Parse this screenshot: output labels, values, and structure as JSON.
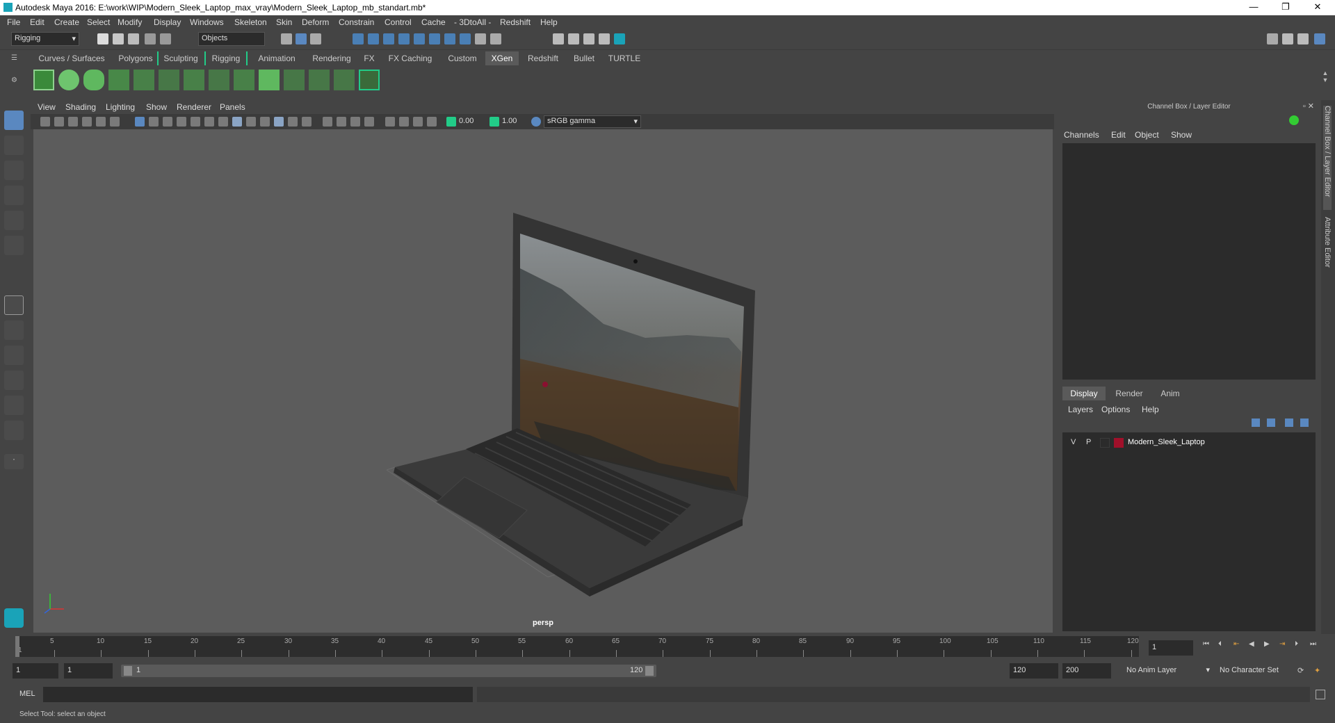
{
  "window": {
    "title": "Autodesk Maya 2016: E:\\work\\WIP\\Modern_Sleek_Laptop_max_vray\\Modern_Sleek_Laptop_mb_standart.mb*",
    "minimize": "—",
    "maximize": "❐",
    "close": "✕"
  },
  "menu": [
    "File",
    "Edit",
    "Create",
    "Select",
    "Modify",
    "Display",
    "Windows",
    "Skeleton",
    "Skin",
    "Deform",
    "Constrain",
    "Control",
    "Cache",
    "- 3DtoAll -",
    "Redshift",
    "Help"
  ],
  "toolbar": {
    "mode": "Rigging",
    "objects_field": "Objects"
  },
  "shelf_tabs": [
    "Curves / Surfaces",
    "Polygons",
    "Sculpting",
    "Rigging",
    "Animation",
    "Rendering",
    "FX",
    "FX Caching",
    "Custom",
    "XGen",
    "Redshift",
    "Bullet",
    "TURTLE"
  ],
  "active_shelf_tab": "XGen",
  "viewport": {
    "menu": [
      "View",
      "Shading",
      "Lighting",
      "Show",
      "Renderer",
      "Panels"
    ],
    "exposure": "0.00",
    "gamma": "1.00",
    "color_space": "sRGB gamma",
    "camera_label": "persp"
  },
  "channel_box": {
    "title": "Channel Box / Layer Editor",
    "menu": [
      "Channels",
      "Edit",
      "Object",
      "Show"
    ]
  },
  "layer_editor": {
    "tabs": [
      "Display",
      "Render",
      "Anim"
    ],
    "active_tab": "Display",
    "menu": [
      "Layers",
      "Options",
      "Help"
    ],
    "layers": [
      {
        "visible": "V",
        "playback": "P",
        "name": "Modern_Sleek_Laptop",
        "color": "#a0102a"
      }
    ]
  },
  "side_tabs": [
    "Channel Box / Layer Editor",
    "Attribute Editor"
  ],
  "timeline": {
    "ticks": [
      "5",
      "10",
      "15",
      "20",
      "25",
      "30",
      "35",
      "40",
      "45",
      "50",
      "55",
      "60",
      "65",
      "70",
      "75",
      "80",
      "85",
      "90",
      "95",
      "100",
      "105",
      "110",
      "115",
      "120"
    ],
    "start_label": "1",
    "current_frame": "1"
  },
  "range": {
    "start": "1",
    "playback_start": "1",
    "slider_start": "1",
    "slider_end": "120",
    "playback_end": "120",
    "end": "200",
    "anim_layer": "No Anim Layer",
    "character_set": "No Character Set"
  },
  "command_line": {
    "label": "MEL"
  },
  "help_line": "Select Tool: select an object"
}
